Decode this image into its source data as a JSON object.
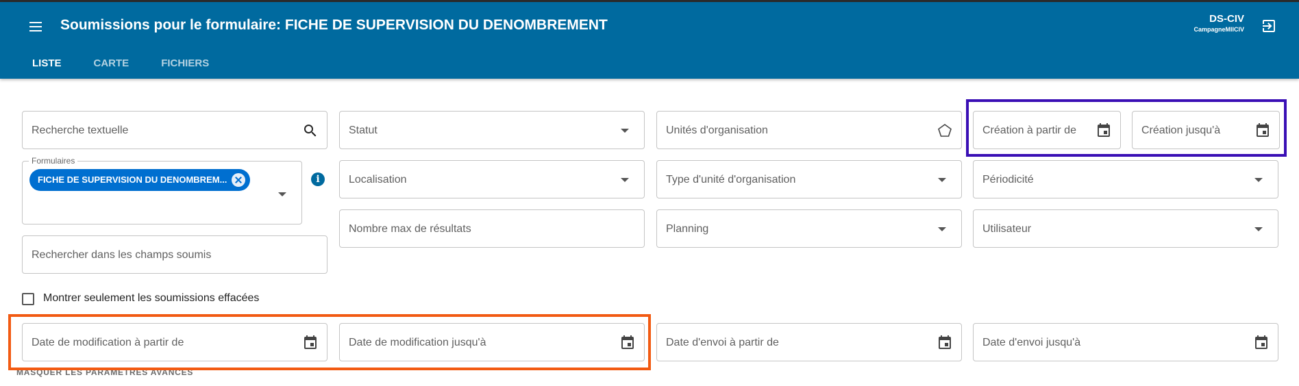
{
  "header": {
    "title": "Soumissions pour le formulaire: FICHE DE SUPERVISION DU DENOMBREMENT",
    "user": "DS-CIV",
    "campaign": "CampagneMIICIV",
    "tabs": [
      "LISTE",
      "CARTE",
      "FICHIERS"
    ],
    "active_tab": "LISTE",
    "bar_color": "#006a9f"
  },
  "filters": {
    "text_search": "Recherche textuelle",
    "status": "Statut",
    "org_units": "Unités d'organisation",
    "created_from": "Création à partir de",
    "created_to": "Création jusqu'à",
    "forms_legend": "Formulaires",
    "form_chip": "FICHE DE SUPERVISION DU DENOMBREM...",
    "location": "Localisation",
    "org_unit_type": "Type d'unité d'organisation",
    "periodicity": "Périodicité",
    "max_results": "Nombre max de résultats",
    "planning": "Planning",
    "user": "Utilisateur",
    "search_fields": "Rechercher dans les champs soumis",
    "deleted_only": "Montrer seulement les soumissions effacées",
    "modified_from": "Date de modification à partir de",
    "modified_to": "Date de modification jusqu'à",
    "sent_from": "Date d'envoi à partir de",
    "sent_to": "Date d'envoi jusqu'à",
    "hide_advanced": "MASQUER LES PARAMÈTRES AVANCÉS"
  },
  "highlights": {
    "purple": "#3a0fb5",
    "orange": "#f25a12"
  }
}
